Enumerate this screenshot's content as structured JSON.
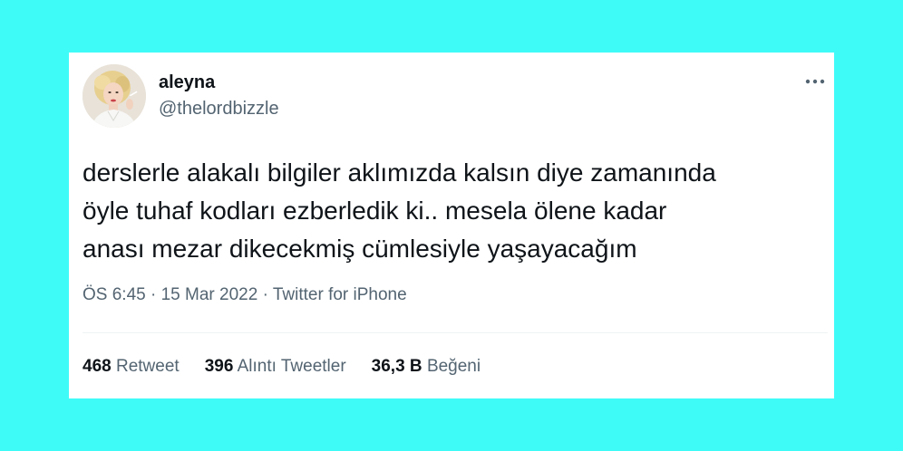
{
  "user": {
    "name": "aleyna",
    "handle": "@thelordbizzle"
  },
  "tweet": {
    "lines": [
      "derslerle alakalı bilgiler aklımızda kalsın diye zamanında",
      "öyle tuhaf kodları ezberledik ki.. mesela ölene kadar",
      "anası mezar dikecekmiş cümlesiyle yaşayacağım"
    ]
  },
  "meta": {
    "time": "ÖS 6:45",
    "sep1": " · ",
    "date": "15 Mar 2022",
    "sep2": " · ",
    "source": "Twitter for iPhone"
  },
  "stats": {
    "retweets": {
      "count": "468",
      "label": "Retweet"
    },
    "quotes": {
      "count": "396",
      "label": "Alıntı Tweetler"
    },
    "likes": {
      "count": "36,3 B",
      "label": "Beğeni"
    }
  },
  "icons": {
    "more": "more-dots-icon",
    "avatar": "profile-photo"
  },
  "colors": {
    "background": "#3ffbf8",
    "card": "#ffffff",
    "text": "#0f1419",
    "secondary": "#536471",
    "divider": "#eff3f4"
  }
}
